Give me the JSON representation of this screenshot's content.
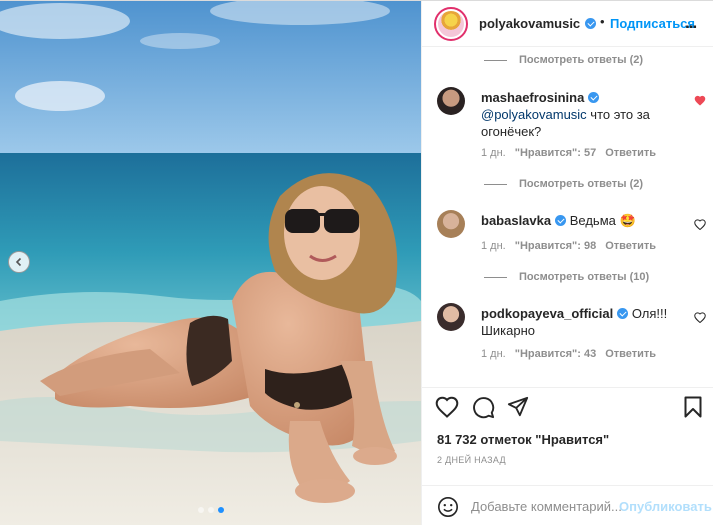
{
  "header": {
    "username": "polyakovamusic",
    "separator": "•",
    "follow_label": "Подписаться",
    "more_label": "..."
  },
  "comments": {
    "view_replies_top": "Посмотреть ответы (2)",
    "items": [
      {
        "username": "mashaefrosinina",
        "mention": "@polyakovamusic",
        "text": " что это за огонёчек?",
        "time": "1 дн.",
        "likes": "\"Нравится\": 57",
        "reply": "Ответить",
        "view_replies": "Посмотреть ответы (2)",
        "liked": true
      },
      {
        "username": "babaslavka",
        "text": "Ведьма 🤩",
        "time": "1 дн.",
        "likes": "\"Нравится\": 98",
        "reply": "Ответить",
        "view_replies": "Посмотреть ответы (10)",
        "liked": false
      },
      {
        "username": "podkopayeva_official",
        "text": "Оля!!! Шикарно",
        "time": "1 дн.",
        "likes": "\"Нравится\": 43",
        "reply": "Ответить",
        "liked": false
      }
    ]
  },
  "post": {
    "likes_text": "81 732 отметок \"Нравится\"",
    "date": "2 ДНЕЙ НАЗАД",
    "carousel_current": 3,
    "carousel_total": 3
  },
  "add_comment": {
    "placeholder": "Добавьте комментарий...",
    "publish_label": "Опубликовать"
  },
  "colors": {
    "accent": "#0095f6",
    "liked_heart": "#ed4956",
    "verified": "#3897f0"
  }
}
